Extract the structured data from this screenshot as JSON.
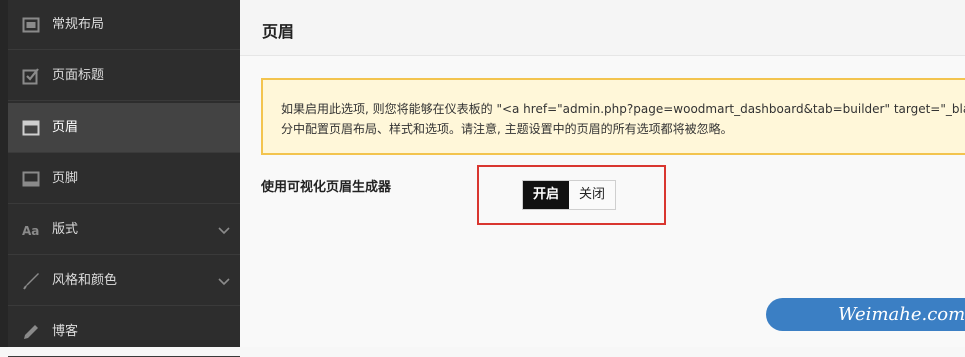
{
  "sidebar": {
    "items": [
      {
        "label": "常规布局",
        "icon": "layout-icon"
      },
      {
        "label": "页面标题",
        "icon": "checkbox-icon"
      },
      {
        "label": "页眉",
        "icon": "header-window-icon"
      },
      {
        "label": "页脚",
        "icon": "footer-window-icon"
      },
      {
        "label": "版式",
        "icon": "typography-icon"
      },
      {
        "label": "风格和颜色",
        "icon": "brush-icon"
      },
      {
        "label": "博客",
        "icon": "pencil-icon"
      }
    ],
    "active_index": 2
  },
  "main": {
    "title": "页眉",
    "notice_line1": "如果启用此选项, 则您将能够在仪表板的 \"<a href=\"admin.php?page=woodmart_dashboard&tab=builder\" target=\"_blank\">",
    "notice_line2": "分中配置页眉布局、样式和选项。请注意, 主题设置中的页眉的所有选项都将被忽略。",
    "option_label": "使用可视化页眉生成器",
    "toggle": {
      "on_label": "开启",
      "off_label": "关闭",
      "selected": "on"
    }
  },
  "watermark": {
    "text": "Weimahe.com"
  },
  "colors": {
    "sidebar_bg": "#2d2d2d",
    "sidebar_active": "#434343",
    "notice_bg": "#fff7d9",
    "notice_border": "#f3c44e",
    "highlight_border": "#d9362f",
    "watermark_bg": "#3b7fc4"
  }
}
